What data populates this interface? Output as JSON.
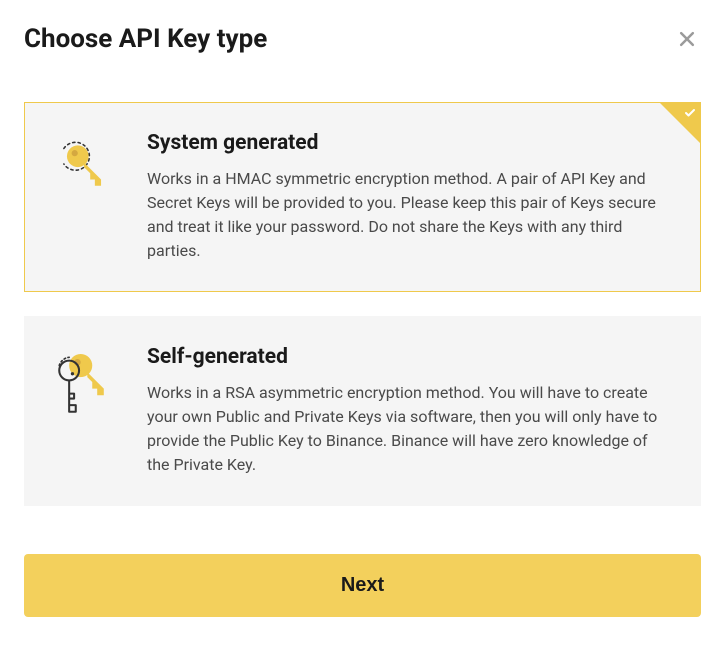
{
  "header": {
    "title": "Choose API Key type"
  },
  "options": [
    {
      "title": "System generated",
      "description": "Works in a HMAC symmetric encryption method. A pair of API Key and Secret Keys will be provided to you. Please keep this pair of Keys secure and treat it like your password. Do not share the Keys with any third parties.",
      "selected": true
    },
    {
      "title": "Self-generated",
      "description": "Works in a RSA asymmetric encryption method. You will have to create your own Public and Private Keys via software, then you will only have to provide the Public Key to Binance. Binance will have zero knowledge of the Private Key.",
      "selected": false
    }
  ],
  "buttons": {
    "next": "Next"
  }
}
